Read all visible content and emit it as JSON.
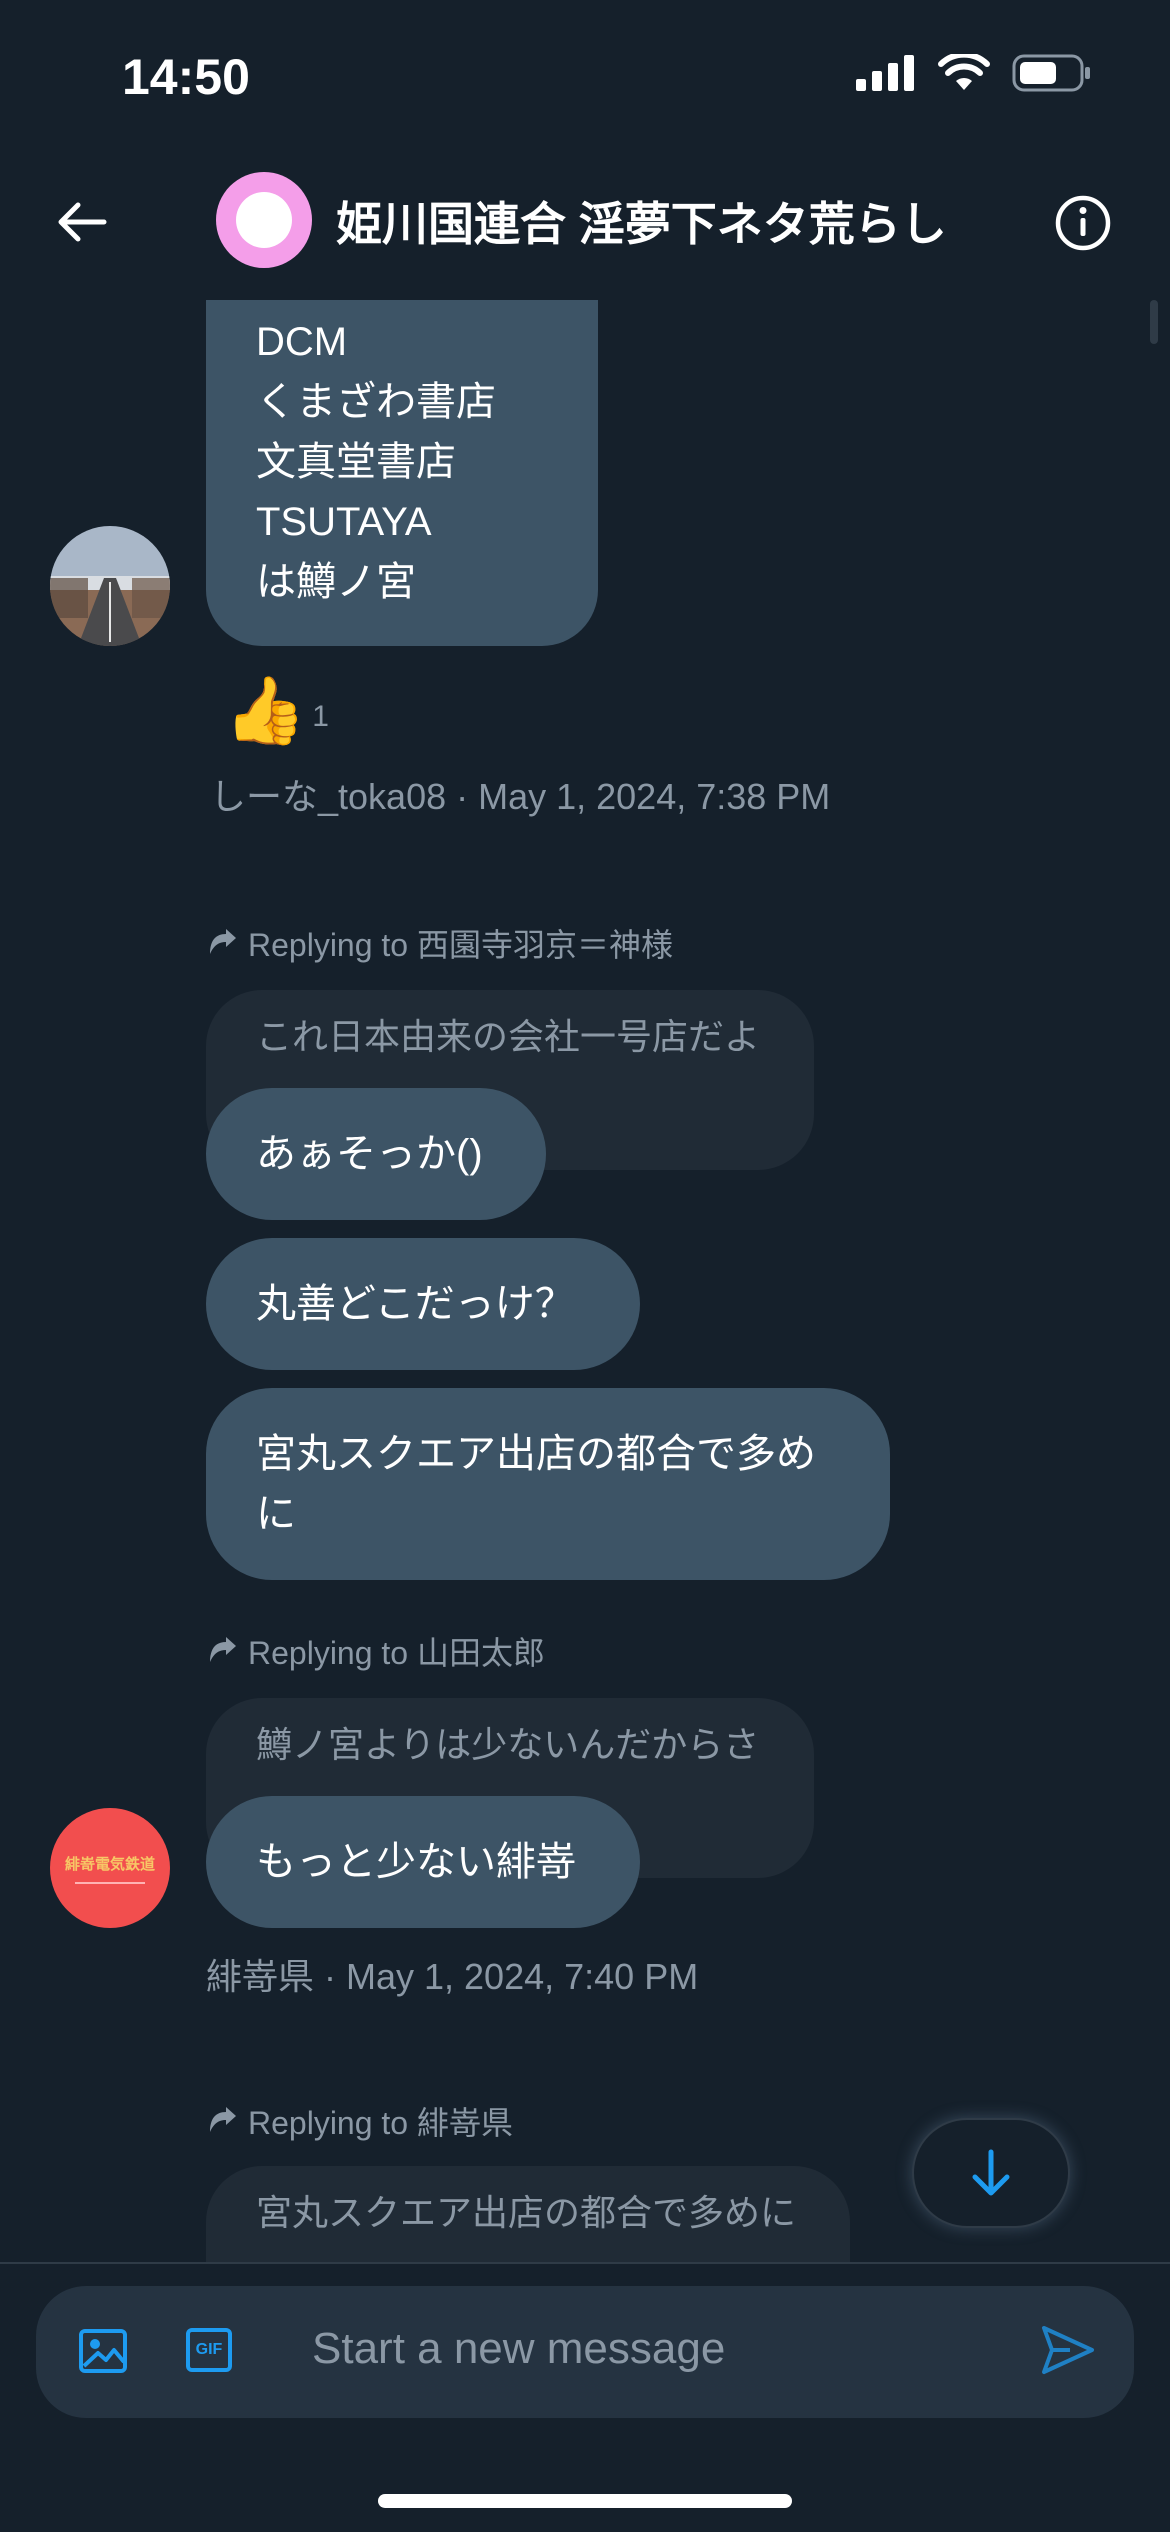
{
  "status_bar": {
    "time": "14:50"
  },
  "header": {
    "title": "姫川国連合 淫夢下ネタ荒らし"
  },
  "messages": {
    "m1": {
      "lines": [
        "DCM",
        "くまざわ書店",
        "文真堂書店",
        "TSUTAYA",
        "は鱒ノ宮"
      ],
      "reaction_emoji": "👍",
      "reaction_count": "1",
      "meta": "しーな_toka08 · May 1, 2024, 7:38 PM"
    },
    "m2": {
      "reply_label": "Replying to 西園寺羽京＝神様",
      "quote": "これ日本由来の会社一号店だよ",
      "texts": [
        "あぁそっか()",
        "丸善どこだっけ？",
        "宮丸スクエア出店の都合で多めに"
      ]
    },
    "m3": {
      "reply_label": "Replying to 山田太郎",
      "quote": "鱒ノ宮よりは少ないんだからさ",
      "text": "もっと少ない緋嵜",
      "meta": "緋嵜県 · May 1, 2024, 7:40 PM",
      "avatar_text": "緋嵜電気鉄道"
    },
    "m4": {
      "reply_label": "Replying to 緋嵜県",
      "quote": "宮丸スクエア出店の都合で多めに"
    }
  },
  "composer": {
    "placeholder": "Start a new message",
    "gif_label": "GIF"
  },
  "colors": {
    "background": "#15202b",
    "bubble": "#3d5466",
    "accent": "#1d9bf0",
    "quote_bg": "#202b36"
  }
}
